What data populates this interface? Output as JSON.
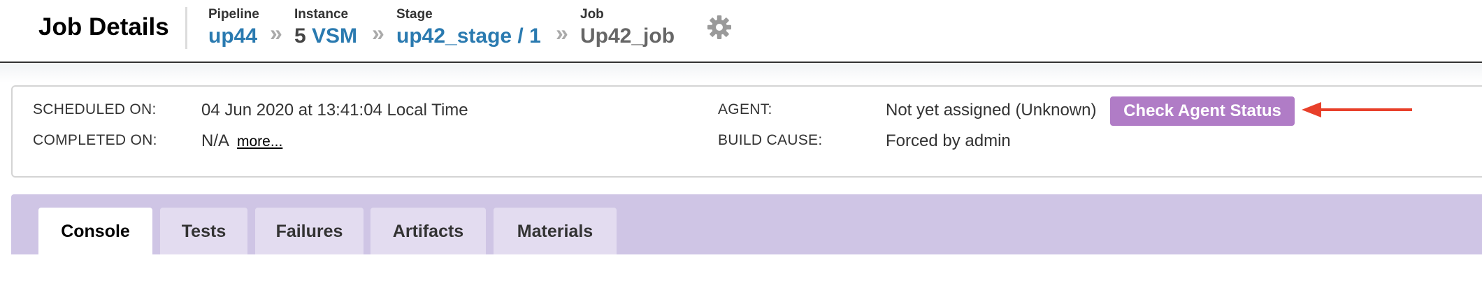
{
  "header": {
    "title": "Job Details",
    "breadcrumbs": [
      {
        "label": "Pipeline",
        "value": "up44"
      },
      {
        "label": "Instance",
        "value_number": "5",
        "value_link": "VSM"
      },
      {
        "label": "Stage",
        "value": "up42_stage / 1"
      },
      {
        "label": "Job",
        "value": "Up42_job"
      }
    ],
    "separator": "»",
    "settings_icon": "gear-icon"
  },
  "summary": {
    "scheduled_label": "SCHEDULED ON:",
    "scheduled_value": "04 Jun 2020 at 13:41:04 Local Time",
    "completed_label": "COMPLETED ON:",
    "completed_value": "N/A",
    "more_link": "more...",
    "agent_label": "AGENT:",
    "agent_value": "Not yet assigned (Unknown)",
    "check_agent_button": "Check Agent Status",
    "build_cause_label": "BUILD CAUSE:",
    "build_cause_value": "Forced by admin"
  },
  "tabs": [
    {
      "label": "Console",
      "active": true
    },
    {
      "label": "Tests",
      "active": false
    },
    {
      "label": "Failures",
      "active": false
    },
    {
      "label": "Artifacts",
      "active": false
    },
    {
      "label": "Materials",
      "active": false
    }
  ],
  "colors": {
    "link": "#2a7ab0",
    "button": "#b07cc6",
    "tab_panel": "#cfc5e5",
    "arrow": "#e8402a"
  }
}
